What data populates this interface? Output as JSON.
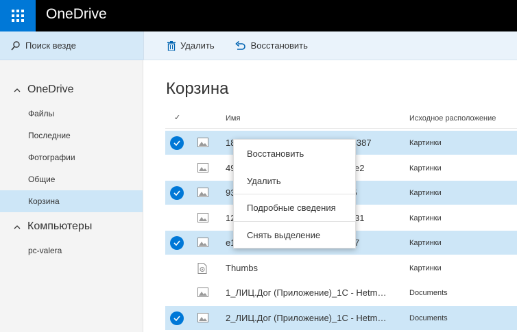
{
  "app": {
    "title": "OneDrive"
  },
  "search": {
    "label": "Поиск везде"
  },
  "commands": {
    "delete": "Удалить",
    "restore": "Восстановить"
  },
  "sidebar": {
    "onedrive": {
      "title": "OneDrive",
      "items": [
        {
          "label": "Файлы"
        },
        {
          "label": "Последние"
        },
        {
          "label": "Фотографии"
        },
        {
          "label": "Общие"
        },
        {
          "label": "Корзина"
        }
      ]
    },
    "computers": {
      "title": "Компьютеры",
      "items": [
        {
          "label": "pc-valera"
        }
      ]
    }
  },
  "main": {
    "title": "Корзина",
    "columns": {
      "check": "✓",
      "name": "Имя",
      "location": "Исходное расположение"
    },
    "rows": [
      {
        "name": "18??f?9b?o?c?84?71??4b?817b387",
        "location": "Картинки",
        "selected": true,
        "icon": "image-icon"
      },
      {
        "name": "49????????????????????712ae2",
        "location": "Картинки",
        "selected": false,
        "icon": "image-icon"
      },
      {
        "name": "93????????????????????9d7f5",
        "location": "Картинки",
        "selected": true,
        "icon": "image-icon"
      },
      {
        "name": "12????????????????????4a8731",
        "location": "Картинки",
        "selected": false,
        "icon": "image-icon"
      },
      {
        "name": "e1????????????????????66ad7",
        "location": "Картинки",
        "selected": true,
        "icon": "image-icon"
      },
      {
        "name": "Thumbs",
        "location": "Картинки",
        "selected": false,
        "icon": "system-file-icon"
      },
      {
        "name": "1_ЛИЦ.Дог (Приложение)_1С - Hetm…",
        "location": "Documents",
        "selected": false,
        "icon": "image-icon"
      },
      {
        "name": "2_ЛИЦ.Дог (Приложение)_1С - Hetm…",
        "location": "Documents",
        "selected": true,
        "icon": "image-icon"
      }
    ]
  },
  "context_menu": {
    "items": [
      {
        "label": "Восстановить"
      },
      {
        "label": "Удалить"
      },
      {
        "label": "Подробные сведения"
      },
      {
        "label": "Снять выделение"
      }
    ]
  },
  "colors": {
    "accent": "#0078d7",
    "selection": "#cde6f7",
    "topbar": "#000000"
  }
}
